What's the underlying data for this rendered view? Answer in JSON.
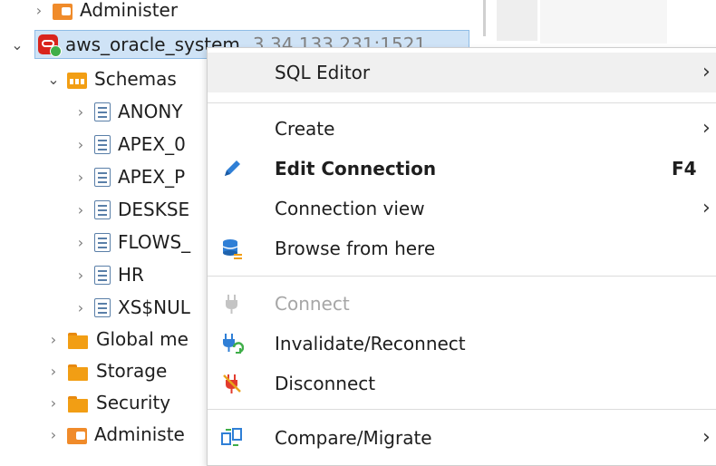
{
  "tree": {
    "rows": [
      {
        "label": "Administer"
      },
      {
        "label": "aws_oracle_system",
        "host": "3.34.133.231:1521"
      },
      {
        "label": "Schemas"
      },
      {
        "label": "ANONY"
      },
      {
        "label": "APEX_0"
      },
      {
        "label": "APEX_P"
      },
      {
        "label": "DESKSE"
      },
      {
        "label": "FLOWS_"
      },
      {
        "label": "HR"
      },
      {
        "label": "XS$NUL"
      },
      {
        "label": "Global me"
      },
      {
        "label": "Storage"
      },
      {
        "label": "Security"
      },
      {
        "label": "Administe"
      }
    ]
  },
  "menu": {
    "items": [
      {
        "label": "SQL Editor",
        "arrow": "›"
      },
      {
        "label": "Create",
        "arrow": "›"
      },
      {
        "label": "Edit Connection",
        "shortcut": "F4"
      },
      {
        "label": "Connection view",
        "arrow": "›"
      },
      {
        "label": "Browse from here"
      },
      {
        "label": "Connect"
      },
      {
        "label": "Invalidate/Reconnect"
      },
      {
        "label": "Disconnect"
      },
      {
        "label": "Compare/Migrate",
        "arrow": "›"
      }
    ]
  },
  "colors": {
    "selection": "#cfe3f6",
    "folder": "#f29e14",
    "connection": "#d9241c"
  }
}
